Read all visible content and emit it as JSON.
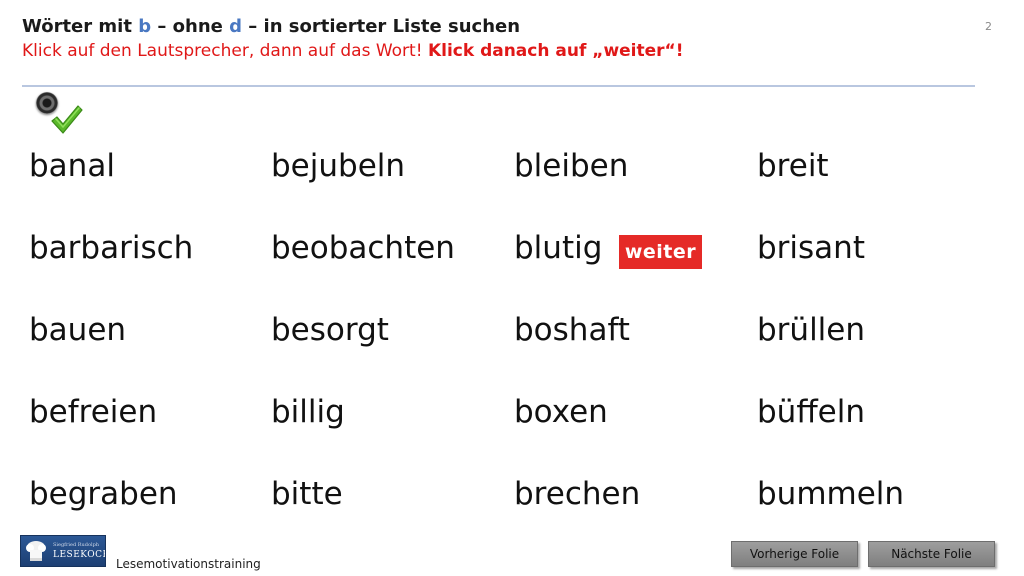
{
  "slide": {
    "title_prefix": "Wörter mit ",
    "title_letter_b": "b",
    "title_mid": " – ohne ",
    "title_letter_d": "d",
    "title_suffix": " – in sortierter Liste suchen",
    "instruction": "Klick auf den Lautsprecher, dann auf das Wort! ",
    "instruction_bold": "Klick danach auf „weiter“!",
    "number": "2",
    "highlight_color": "#4a78c2",
    "instruction_color": "#e01818"
  },
  "icons": {
    "speaker": "speaker-icon",
    "check": "checkmark-icon"
  },
  "words": {
    "col1": [
      "banal",
      "barbarisch",
      "bauen",
      "befreien",
      "begraben"
    ],
    "col2": [
      "bejubeln",
      "beobachten",
      "besorgt",
      "billig",
      "bitte"
    ],
    "col3": [
      "bleiben",
      "blutig",
      "boshaft",
      "boxen",
      "brechen"
    ],
    "col4": [
      "breit",
      "brisant",
      "brüllen",
      "büffeln",
      "bummeln"
    ]
  },
  "weiter_button": {
    "label": "weiter",
    "color": "#e52a27"
  },
  "footer": {
    "logo_small": "Siegfried Rudolph",
    "logo_big": "LESEKOCH",
    "label": "Lesemotivationstraining",
    "prev_label": "Vorherige  Folie",
    "next_label": "Nächste  Folie"
  }
}
